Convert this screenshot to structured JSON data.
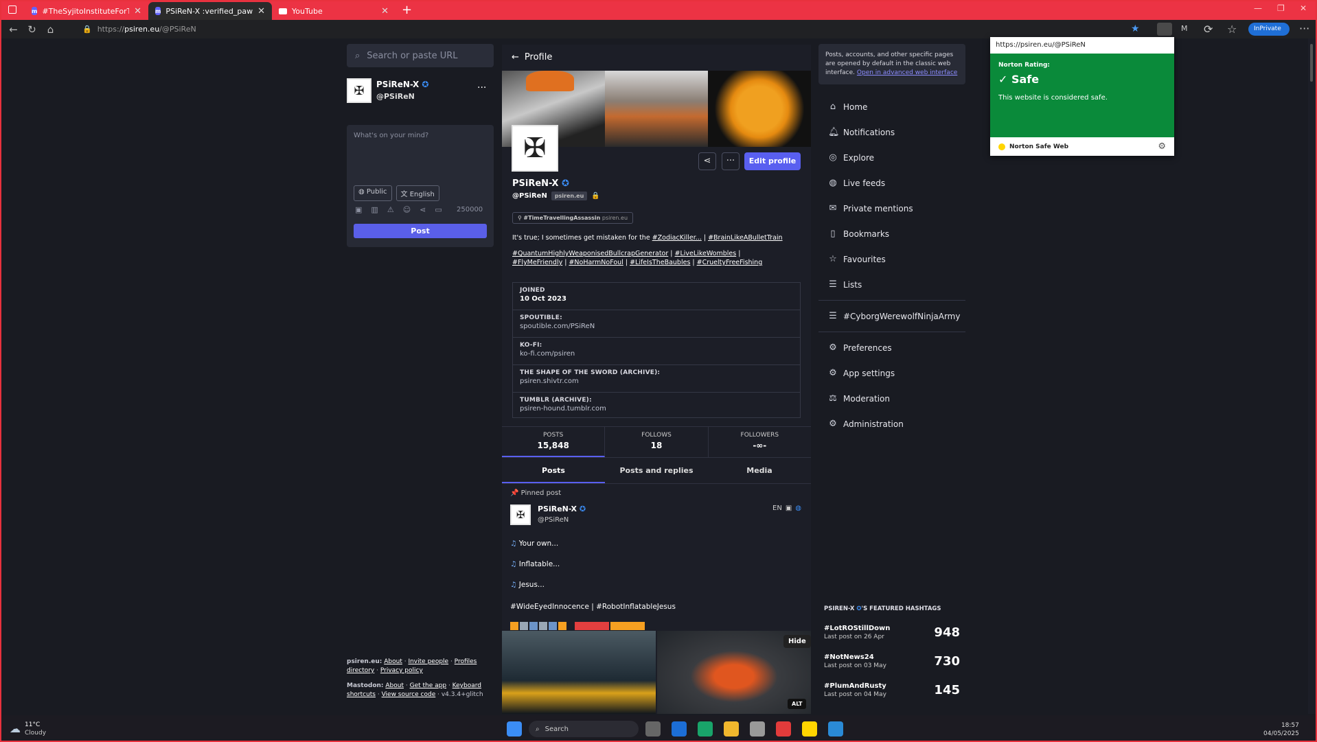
{
  "browser": {
    "tabs": [
      {
        "title": "#TheSyjitoInstituteForTheTermin"
      },
      {
        "title": "PSiReN-X :verified_paw: (@PSiReN"
      },
      {
        "title": "YouTube"
      }
    ],
    "url_prefix": "https://",
    "url_host": "psiren.eu",
    "url_path": "/@PSiReN",
    "inprivate_label": "InPrivate"
  },
  "compose": {
    "search_placeholder": "Search or paste URL",
    "display_name": "PSiReN-X",
    "handle": "@PSiReN",
    "textarea_placeholder": "What's on your mind?",
    "visibility": "Public",
    "language": "English",
    "char_count": "250000",
    "post_label": "Post"
  },
  "footer": {
    "instance_label": "psiren.eu:",
    "instance_links": [
      "About",
      "Invite people",
      "Profiles directory",
      "Privacy policy"
    ],
    "mastodon_label": "Mastodon:",
    "mastodon_links": [
      "About",
      "Get the app",
      "Keyboard shortcuts",
      "View source code"
    ],
    "version": "v4.3.4+glitch"
  },
  "profile": {
    "header": "Profile",
    "display_name": "PSiReN-X",
    "handle": "@PSiReN",
    "domain_badge": "psiren.eu",
    "edit_label": "Edit profile",
    "role_tag": "#TimeTravellingAssassin",
    "role_domain": "psiren.eu",
    "bio_prefix": "It's true; I sometimes get mistaken for the",
    "bio_tag1": "#ZodiacKiller...",
    "bio_sep": "|",
    "bio_tag2": "#BrainLikeABulletTrain",
    "bio_line2": [
      "#QuantumHighlyWeaponisedBullcrapGenerator",
      "#LiveLikeWombles",
      "#FlyMeFriendly",
      "#NoHarmNoFoul",
      "#LifeIsTheBaubles",
      "#CrueltyFreeFishing"
    ],
    "fields": [
      {
        "k": "JOINED",
        "v": "10 Oct 2023"
      },
      {
        "k": "SPOUTIBLE:",
        "v": "spoutible.com/PSiReN"
      },
      {
        "k": "KO-FI:",
        "v": "ko-fi.com/psiren"
      },
      {
        "k": "THE SHAPE OF THE SWORD (ARCHIVE):",
        "v": "psiren.shivtr.com"
      },
      {
        "k": "TUMBLR (ARCHIVE):",
        "v": "psiren-hound.tumblr.com"
      }
    ],
    "stats": [
      {
        "k": "POSTS",
        "v": "15,848"
      },
      {
        "k": "FOLLOWS",
        "v": "18"
      },
      {
        "k": "FOLLOWERS",
        "v": "-∞-"
      }
    ],
    "tabs": [
      "Posts",
      "Posts and replies",
      "Media"
    ]
  },
  "post": {
    "pinned_label": "Pinned post",
    "display_name": "PSiReN-X",
    "handle": "@PSiReN",
    "lang": "EN",
    "lines": [
      "Your own...",
      "Inflatable...",
      "Jesus..."
    ],
    "hashtags": "#WideEyedInnocence | #RobotInflatableJesus",
    "hide_label": "Hide",
    "alt_label": "ALT"
  },
  "nav": {
    "notice": "Posts, accounts, and other specific pages are opened by default in the classic web interface.",
    "notice_link": "Open in advanced web interface",
    "items": [
      "Home",
      "Notifications",
      "Explore",
      "Live feeds",
      "Private mentions",
      "Bookmarks",
      "Favourites",
      "Lists"
    ],
    "list_item": "#CyborgWerewolfNinjaArmy",
    "settings": [
      "Preferences",
      "App settings",
      "Moderation",
      "Administration"
    ]
  },
  "featured": {
    "title_name": "PSIREN-X",
    "title_suffix": "'S FEATURED HASHTAGS",
    "tags": [
      {
        "tag": "#LotROStillDown",
        "last": "Last post on 26 Apr",
        "count": "948"
      },
      {
        "tag": "#NotNews24",
        "last": "Last post on 03 May",
        "count": "730"
      },
      {
        "tag": "#PlumAndRusty",
        "last": "Last post on 04 May",
        "count": "145"
      }
    ]
  },
  "norton": {
    "url": "https://psiren.eu/@PSiReN",
    "rating_label": "Norton Rating:",
    "rating": "Safe",
    "message": "This website is considered safe.",
    "brand": "Norton Safe Web"
  },
  "taskbar": {
    "temp": "11°C",
    "weather": "Cloudy",
    "search": "Search",
    "time": "18:57",
    "date": "04/05/2025"
  },
  "colors": {
    "accent": "#595ff0",
    "norton_green": "#0a8a3a",
    "frame": "#ec3344",
    "verified": "#3b8df5"
  }
}
